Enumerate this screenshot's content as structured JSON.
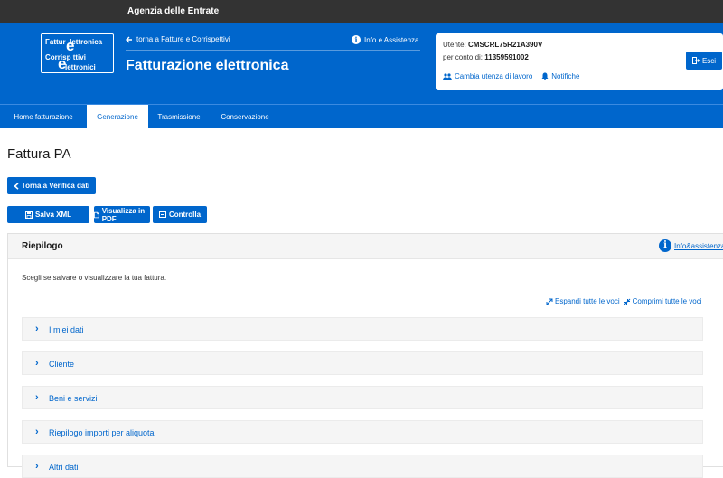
{
  "topbar": {
    "agency": "Agenzia delle Entrate"
  },
  "logo": {
    "line1": "Fattur",
    "line1_e": "e",
    "line1_rest": "lettronica",
    "line2": "Corrisp",
    "line2_e": "e",
    "line2_rest": "ttivi",
    "line3": "lettronici"
  },
  "header": {
    "back_link": "torna a Fatture e Corrispettivi",
    "info_link": "Info e Assistenza",
    "title": "Fatturazione elettronica"
  },
  "user": {
    "utente_label": "Utente:",
    "utente_value": "CMSCRL75R21A390V",
    "conto_label": "per conto di:",
    "conto_value": "11359591002",
    "change_user": "Cambia utenza di lavoro",
    "notifications": "Notifiche",
    "logout": "Esci"
  },
  "nav": {
    "tabs": [
      {
        "label": "Home fatturazione",
        "active": false
      },
      {
        "label": "Generazione",
        "active": true
      },
      {
        "label": "Trasmissione",
        "active": false
      },
      {
        "label": "Conservazione",
        "active": false
      }
    ]
  },
  "page": {
    "title": "Fattura PA",
    "back_button": "Torna a Verifica dati",
    "save_xml": "Salva XML",
    "view_pdf": "Visualizza in PDF",
    "check": "Controlla"
  },
  "panel": {
    "title": "Riepilogo",
    "info": "Info&assistenza",
    "instructions": "Scegli se salvare o visualizzare la tua fattura.",
    "expand_all": "Espandi tutte le voci",
    "collapse_all": "Comprimi tutte le voci",
    "sections": [
      {
        "label": "I miei dati"
      },
      {
        "label": "Cliente"
      },
      {
        "label": "Beni e servizi"
      },
      {
        "label": "Riepilogo importi per aliquota"
      },
      {
        "label": "Altri dati"
      }
    ]
  },
  "colors": {
    "primary": "#0066cc",
    "topbar": "#333333",
    "panel_bg": "#f5f5f5"
  }
}
